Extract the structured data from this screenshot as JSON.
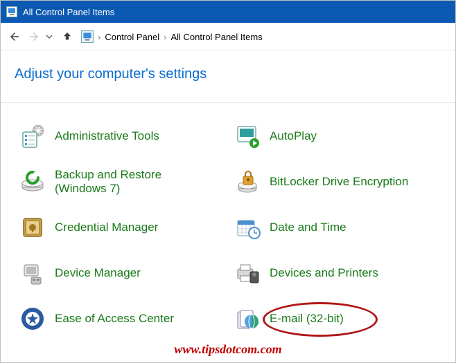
{
  "window": {
    "title": "All Control Panel Items"
  },
  "breadcrumb": {
    "root": "Control Panel",
    "current": "All Control Panel Items"
  },
  "heading": "Adjust your computer's settings",
  "items": {
    "admin_tools": "Administrative Tools",
    "autoplay": "AutoPlay",
    "backup_restore": "Backup and Restore (Windows 7)",
    "bitlocker": "BitLocker Drive Encryption",
    "credential_mgr": "Credential Manager",
    "date_time": "Date and Time",
    "device_mgr": "Device Manager",
    "devices_printers": "Devices and Printers",
    "ease_access": "Ease of Access Center",
    "email": "E-mail (32-bit)"
  },
  "watermark": "www.tipsdotcom.com"
}
